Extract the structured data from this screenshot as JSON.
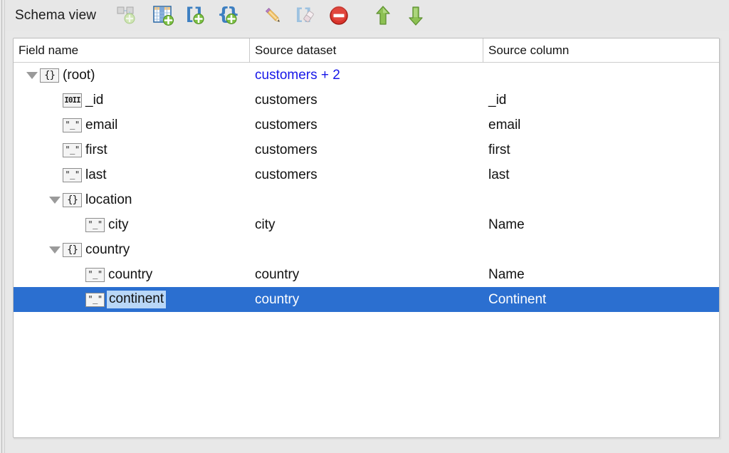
{
  "toolbar": {
    "title": "Schema view",
    "buttons": [
      {
        "name": "add-link-icon",
        "label": "Add link",
        "disabled": true
      },
      {
        "name": "add-table-icon",
        "label": "Add table column",
        "disabled": false
      },
      {
        "name": "add-array-icon",
        "label": "Add array",
        "disabled": false
      },
      {
        "name": "add-object-icon",
        "label": "Add object",
        "disabled": false
      },
      {
        "name": "edit-pencil-icon",
        "label": "Edit",
        "disabled": false
      },
      {
        "name": "clear-brackets-icon",
        "label": "Clear",
        "disabled": true
      },
      {
        "name": "delete-icon",
        "label": "Delete",
        "disabled": false
      },
      {
        "name": "move-up-icon",
        "label": "Move up",
        "disabled": false
      },
      {
        "name": "move-down-icon",
        "label": "Move down",
        "disabled": false
      }
    ]
  },
  "table": {
    "headers": [
      "Field name",
      "Source dataset",
      "Source column"
    ],
    "rows": [
      {
        "depth": 0,
        "expandable": true,
        "icon": "object",
        "field": "(root)",
        "dataset": "customers + 2",
        "dataset_blue": true,
        "column": "",
        "selected": false,
        "editing": false
      },
      {
        "depth": 1,
        "expandable": false,
        "icon": "number",
        "field": "_id",
        "dataset": "customers",
        "dataset_blue": false,
        "column": "_id",
        "selected": false,
        "editing": false
      },
      {
        "depth": 1,
        "expandable": false,
        "icon": "string",
        "field": "email",
        "dataset": "customers",
        "dataset_blue": false,
        "column": "email",
        "selected": false,
        "editing": false
      },
      {
        "depth": 1,
        "expandable": false,
        "icon": "string",
        "field": "first",
        "dataset": "customers",
        "dataset_blue": false,
        "column": "first",
        "selected": false,
        "editing": false
      },
      {
        "depth": 1,
        "expandable": false,
        "icon": "string",
        "field": "last",
        "dataset": "customers",
        "dataset_blue": false,
        "column": "last",
        "selected": false,
        "editing": false
      },
      {
        "depth": 1,
        "expandable": true,
        "icon": "object",
        "field": "location",
        "dataset": "",
        "dataset_blue": false,
        "column": "",
        "selected": false,
        "editing": false
      },
      {
        "depth": 2,
        "expandable": false,
        "icon": "string",
        "field": "city",
        "dataset": "city",
        "dataset_blue": false,
        "column": "Name",
        "selected": false,
        "editing": false
      },
      {
        "depth": 1,
        "expandable": true,
        "icon": "object",
        "field": "country",
        "dataset": "",
        "dataset_blue": false,
        "column": "",
        "selected": false,
        "editing": false
      },
      {
        "depth": 2,
        "expandable": false,
        "icon": "string",
        "field": "country",
        "dataset": "country",
        "dataset_blue": false,
        "column": "Name",
        "selected": false,
        "editing": false
      },
      {
        "depth": 2,
        "expandable": false,
        "icon": "string",
        "field": "continent",
        "dataset": "country",
        "dataset_blue": false,
        "column": "Continent",
        "selected": true,
        "editing": true
      }
    ]
  },
  "icon_glyphs": {
    "object": "{}",
    "string": "\"_\"",
    "number": "I0II"
  },
  "colors": {
    "selection": "#2b6fd0",
    "edit_highlight": "#b9d7f7",
    "link_text": "#1717e8",
    "toolbar_bg": "#e7e7e7",
    "panel_bg": "#ffffff"
  }
}
